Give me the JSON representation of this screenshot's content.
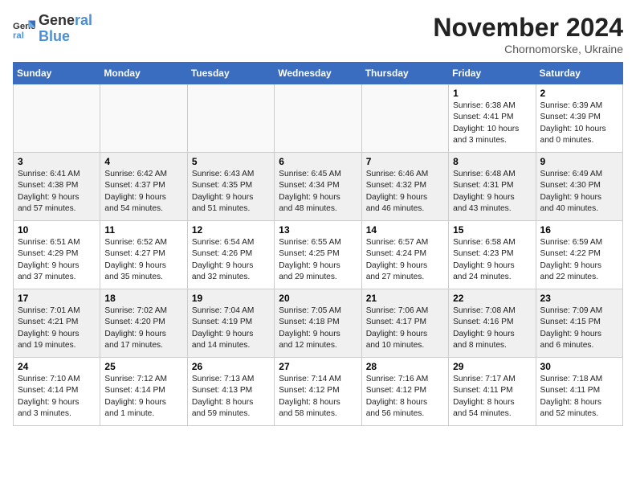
{
  "header": {
    "logo_line1": "General",
    "logo_line2": "Blue",
    "month": "November 2024",
    "location": "Chornomorske, Ukraine"
  },
  "days_of_week": [
    "Sunday",
    "Monday",
    "Tuesday",
    "Wednesday",
    "Thursday",
    "Friday",
    "Saturday"
  ],
  "weeks": [
    {
      "shaded": false,
      "days": [
        {
          "num": "",
          "info": ""
        },
        {
          "num": "",
          "info": ""
        },
        {
          "num": "",
          "info": ""
        },
        {
          "num": "",
          "info": ""
        },
        {
          "num": "",
          "info": ""
        },
        {
          "num": "1",
          "info": "Sunrise: 6:38 AM\nSunset: 4:41 PM\nDaylight: 10 hours\nand 3 minutes."
        },
        {
          "num": "2",
          "info": "Sunrise: 6:39 AM\nSunset: 4:39 PM\nDaylight: 10 hours\nand 0 minutes."
        }
      ]
    },
    {
      "shaded": true,
      "days": [
        {
          "num": "3",
          "info": "Sunrise: 6:41 AM\nSunset: 4:38 PM\nDaylight: 9 hours\nand 57 minutes."
        },
        {
          "num": "4",
          "info": "Sunrise: 6:42 AM\nSunset: 4:37 PM\nDaylight: 9 hours\nand 54 minutes."
        },
        {
          "num": "5",
          "info": "Sunrise: 6:43 AM\nSunset: 4:35 PM\nDaylight: 9 hours\nand 51 minutes."
        },
        {
          "num": "6",
          "info": "Sunrise: 6:45 AM\nSunset: 4:34 PM\nDaylight: 9 hours\nand 48 minutes."
        },
        {
          "num": "7",
          "info": "Sunrise: 6:46 AM\nSunset: 4:32 PM\nDaylight: 9 hours\nand 46 minutes."
        },
        {
          "num": "8",
          "info": "Sunrise: 6:48 AM\nSunset: 4:31 PM\nDaylight: 9 hours\nand 43 minutes."
        },
        {
          "num": "9",
          "info": "Sunrise: 6:49 AM\nSunset: 4:30 PM\nDaylight: 9 hours\nand 40 minutes."
        }
      ]
    },
    {
      "shaded": false,
      "days": [
        {
          "num": "10",
          "info": "Sunrise: 6:51 AM\nSunset: 4:29 PM\nDaylight: 9 hours\nand 37 minutes."
        },
        {
          "num": "11",
          "info": "Sunrise: 6:52 AM\nSunset: 4:27 PM\nDaylight: 9 hours\nand 35 minutes."
        },
        {
          "num": "12",
          "info": "Sunrise: 6:54 AM\nSunset: 4:26 PM\nDaylight: 9 hours\nand 32 minutes."
        },
        {
          "num": "13",
          "info": "Sunrise: 6:55 AM\nSunset: 4:25 PM\nDaylight: 9 hours\nand 29 minutes."
        },
        {
          "num": "14",
          "info": "Sunrise: 6:57 AM\nSunset: 4:24 PM\nDaylight: 9 hours\nand 27 minutes."
        },
        {
          "num": "15",
          "info": "Sunrise: 6:58 AM\nSunset: 4:23 PM\nDaylight: 9 hours\nand 24 minutes."
        },
        {
          "num": "16",
          "info": "Sunrise: 6:59 AM\nSunset: 4:22 PM\nDaylight: 9 hours\nand 22 minutes."
        }
      ]
    },
    {
      "shaded": true,
      "days": [
        {
          "num": "17",
          "info": "Sunrise: 7:01 AM\nSunset: 4:21 PM\nDaylight: 9 hours\nand 19 minutes."
        },
        {
          "num": "18",
          "info": "Sunrise: 7:02 AM\nSunset: 4:20 PM\nDaylight: 9 hours\nand 17 minutes."
        },
        {
          "num": "19",
          "info": "Sunrise: 7:04 AM\nSunset: 4:19 PM\nDaylight: 9 hours\nand 14 minutes."
        },
        {
          "num": "20",
          "info": "Sunrise: 7:05 AM\nSunset: 4:18 PM\nDaylight: 9 hours\nand 12 minutes."
        },
        {
          "num": "21",
          "info": "Sunrise: 7:06 AM\nSunset: 4:17 PM\nDaylight: 9 hours\nand 10 minutes."
        },
        {
          "num": "22",
          "info": "Sunrise: 7:08 AM\nSunset: 4:16 PM\nDaylight: 9 hours\nand 8 minutes."
        },
        {
          "num": "23",
          "info": "Sunrise: 7:09 AM\nSunset: 4:15 PM\nDaylight: 9 hours\nand 6 minutes."
        }
      ]
    },
    {
      "shaded": false,
      "days": [
        {
          "num": "24",
          "info": "Sunrise: 7:10 AM\nSunset: 4:14 PM\nDaylight: 9 hours\nand 3 minutes."
        },
        {
          "num": "25",
          "info": "Sunrise: 7:12 AM\nSunset: 4:14 PM\nDaylight: 9 hours\nand 1 minute."
        },
        {
          "num": "26",
          "info": "Sunrise: 7:13 AM\nSunset: 4:13 PM\nDaylight: 8 hours\nand 59 minutes."
        },
        {
          "num": "27",
          "info": "Sunrise: 7:14 AM\nSunset: 4:12 PM\nDaylight: 8 hours\nand 58 minutes."
        },
        {
          "num": "28",
          "info": "Sunrise: 7:16 AM\nSunset: 4:12 PM\nDaylight: 8 hours\nand 56 minutes."
        },
        {
          "num": "29",
          "info": "Sunrise: 7:17 AM\nSunset: 4:11 PM\nDaylight: 8 hours\nand 54 minutes."
        },
        {
          "num": "30",
          "info": "Sunrise: 7:18 AM\nSunset: 4:11 PM\nDaylight: 8 hours\nand 52 minutes."
        }
      ]
    }
  ]
}
